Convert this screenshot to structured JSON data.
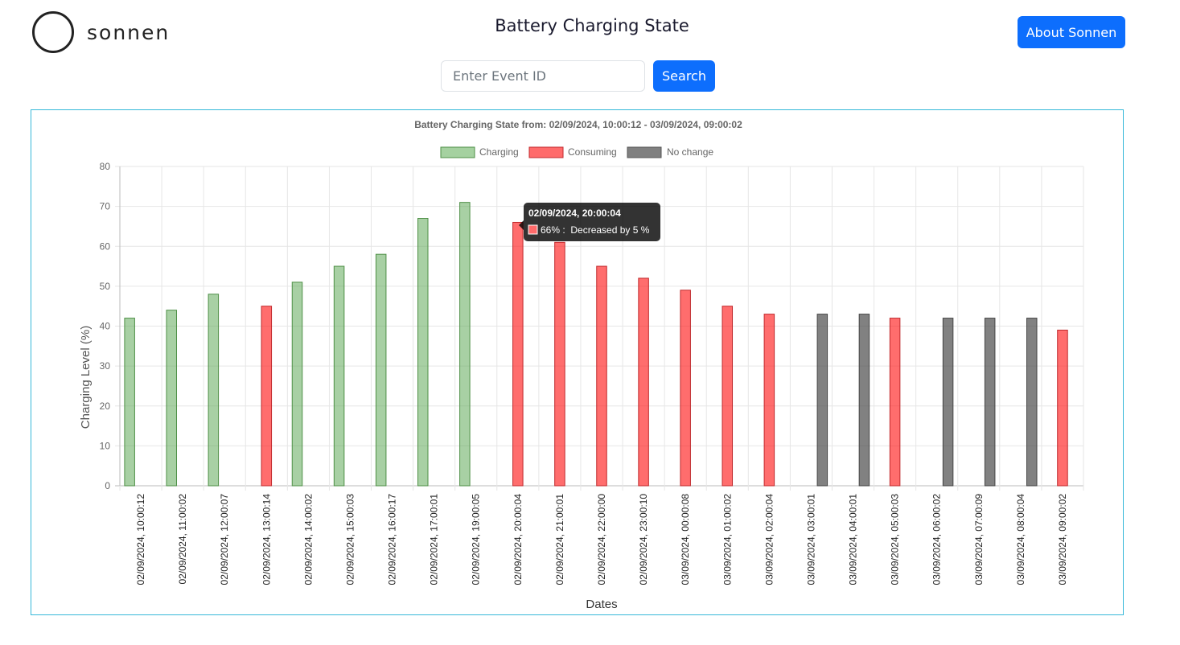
{
  "header": {
    "logo_text": "sonnen",
    "title": "Battery Charging State",
    "about_label": "About Sonnen"
  },
  "search": {
    "placeholder": "Enter Event ID",
    "button_label": "Search"
  },
  "colors": {
    "accent": "#0d6efd",
    "chart_border": "#35b8d9",
    "charging": "#a5d1a0",
    "charging_border": "#4e8f46",
    "consuming": "#ff6b6b",
    "consuming_border": "#c0292c",
    "no_change": "#808080",
    "no_change_border": "#555555"
  },
  "tooltip": {
    "title": "02/09/2024, 20:00:04",
    "body": "66% :  Decreased by 5 %"
  },
  "chart_data": {
    "type": "bar",
    "title": "Battery Charging State from: 02/09/2024, 10:00:12 - 03/09/2024, 09:00:02",
    "xlabel": "Dates",
    "ylabel": "Charging Level (%)",
    "ylim": [
      0,
      80
    ],
    "yticks": [
      0,
      10,
      20,
      30,
      40,
      50,
      60,
      70,
      80
    ],
    "grid": true,
    "legend_position": "top",
    "categories": [
      "02/09/2024, 10:00:12",
      "02/09/2024, 11:00:02",
      "02/09/2024, 12:00:07",
      "02/09/2024, 13:00:14",
      "02/09/2024, 14:00:02",
      "02/09/2024, 15:00:03",
      "02/09/2024, 16:00:17",
      "02/09/2024, 17:00:01",
      "02/09/2024, 19:00:05",
      "02/09/2024, 20:00:04",
      "02/09/2024, 21:00:01",
      "02/09/2024, 22:00:00",
      "02/09/2024, 23:00:10",
      "03/09/2024, 00:00:08",
      "03/09/2024, 01:00:02",
      "03/09/2024, 02:00:04",
      "03/09/2024, 03:00:01",
      "03/09/2024, 04:00:01",
      "03/09/2024, 05:00:03",
      "03/09/2024, 06:00:02",
      "03/09/2024, 07:00:09",
      "03/09/2024, 08:00:04",
      "03/09/2024, 09:00:02"
    ],
    "series": [
      {
        "name": "Charging",
        "values": [
          42,
          44,
          48,
          null,
          51,
          55,
          58,
          67,
          71,
          null,
          null,
          null,
          null,
          null,
          null,
          null,
          null,
          null,
          null,
          null,
          null,
          null,
          null
        ]
      },
      {
        "name": "Consuming",
        "values": [
          null,
          null,
          null,
          45,
          null,
          null,
          null,
          null,
          null,
          66,
          61,
          55,
          52,
          49,
          45,
          43,
          null,
          null,
          42,
          null,
          null,
          null,
          39
        ]
      },
      {
        "name": "No change",
        "values": [
          null,
          null,
          null,
          null,
          null,
          null,
          null,
          null,
          null,
          null,
          null,
          null,
          null,
          null,
          null,
          null,
          43,
          43,
          null,
          42,
          42,
          42,
          null
        ]
      }
    ]
  }
}
